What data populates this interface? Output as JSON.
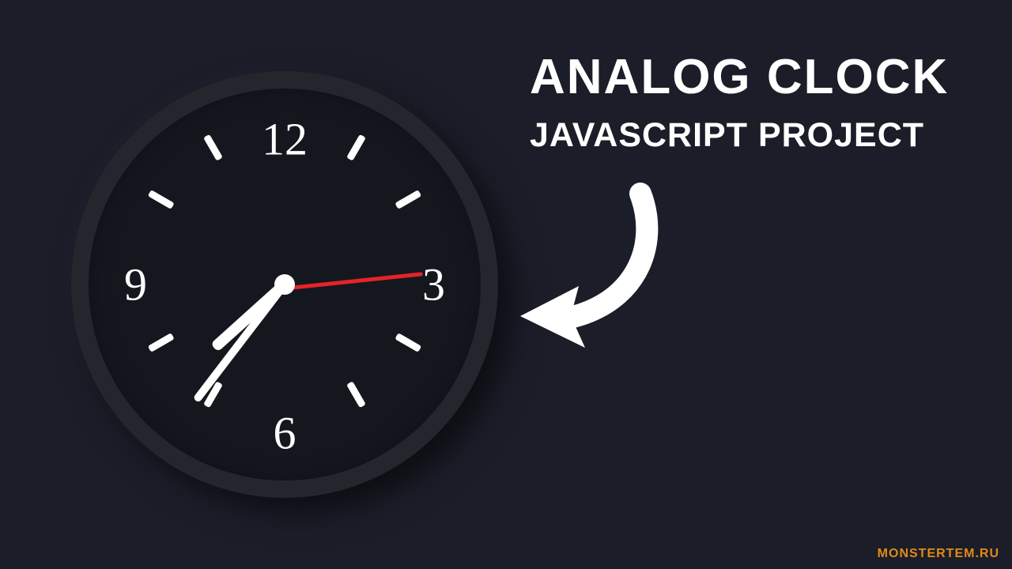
{
  "title": "ANALOG CLOCK",
  "subtitle": "JAVASCRIPT PROJECT",
  "watermark": "MONSTERTEM.RU",
  "clock": {
    "numbers": {
      "n12": "12",
      "n3": "3",
      "n6": "6",
      "n9": "9"
    },
    "time": {
      "hours": 7,
      "minutes": 36,
      "seconds": 14
    },
    "colors": {
      "face": "#15171f",
      "rim": "#24262e",
      "hands": "#ffffff",
      "second_hand": "#e6232a",
      "bg": "#1b1e29"
    }
  }
}
